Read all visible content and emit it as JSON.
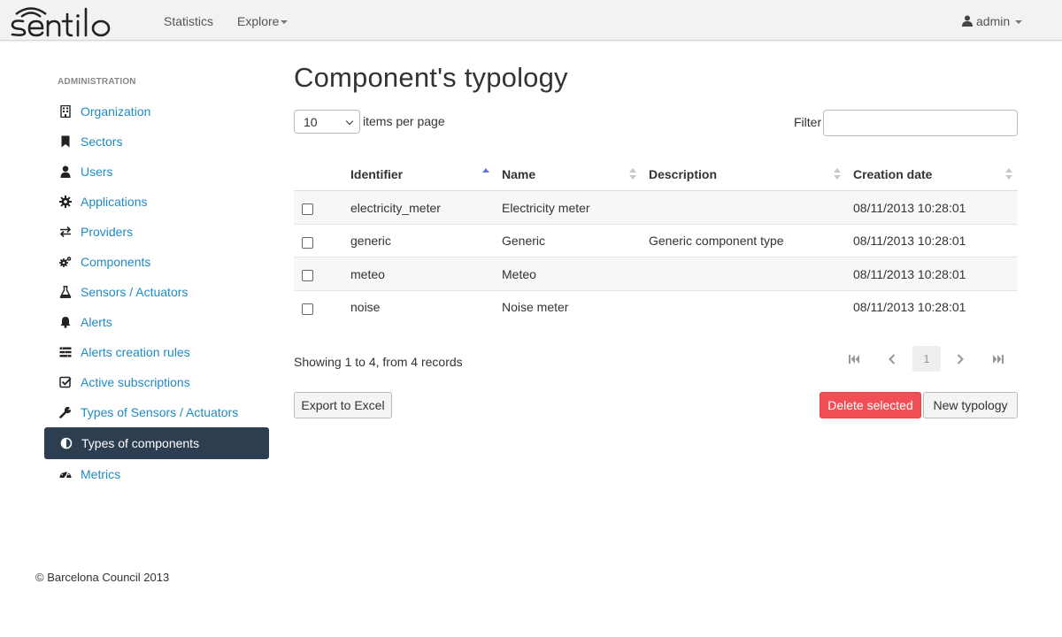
{
  "brand": {
    "logo_text": "sentilo"
  },
  "nav": {
    "statistics": "Statistics",
    "explore": "Explore",
    "user": "admin"
  },
  "sidebar": {
    "title": "ADMINISTRATION",
    "items": [
      {
        "label": "Organization",
        "icon": "building-icon"
      },
      {
        "label": "Sectors",
        "icon": "bookmark-icon"
      },
      {
        "label": "Users",
        "icon": "user-icon"
      },
      {
        "label": "Applications",
        "icon": "gear-icon"
      },
      {
        "label": "Providers",
        "icon": "exchange-icon"
      },
      {
        "label": "Components",
        "icon": "cogs-icon"
      },
      {
        "label": "Sensors / Actuators",
        "icon": "flask-icon"
      },
      {
        "label": "Alerts",
        "icon": "bell-icon"
      },
      {
        "label": "Alerts creation rules",
        "icon": "rules-list-icon"
      },
      {
        "label": "Active subscriptions",
        "icon": "check-square-icon"
      },
      {
        "label": "Types of Sensors / Actuators",
        "icon": "wrench-icon"
      },
      {
        "label": "Types of components",
        "icon": "adjust-icon",
        "active": true
      },
      {
        "label": "Metrics",
        "icon": "dashboard-icon"
      }
    ]
  },
  "main": {
    "title": "Component's typology",
    "per_page_value": "10",
    "per_page_label": "items per page",
    "filter_label": "Filter",
    "filter_value": ""
  },
  "table": {
    "columns": [
      "Identifier",
      "Name",
      "Description",
      "Creation date"
    ],
    "sorted_column": "Identifier",
    "sort_direction": "ascending",
    "rows": [
      {
        "identifier": "electricity_meter",
        "name": "Electricity meter",
        "description": "",
        "created": "08/11/2013 10:28:01"
      },
      {
        "identifier": "generic",
        "name": "Generic",
        "description": "Generic component type",
        "created": "08/11/2013 10:28:01"
      },
      {
        "identifier": "meteo",
        "name": "Meteo",
        "description": "",
        "created": "08/11/2013 10:28:01"
      },
      {
        "identifier": "noise",
        "name": "Noise meter",
        "description": "",
        "created": "08/11/2013 10:28:01"
      }
    ]
  },
  "pagination": {
    "summary": "Showing 1 to 4, from 4 records",
    "current_page": "1"
  },
  "actions": {
    "export": "Export to Excel",
    "delete": "Delete selected",
    "new": "New typology"
  },
  "footer": {
    "copyright": "© Barcelona Council 2013"
  },
  "colors": {
    "link": "#1e8bc3",
    "active_bg": "#2c3e50",
    "danger": "#ef4f55",
    "navbar_bg": "#f2f2f2"
  }
}
